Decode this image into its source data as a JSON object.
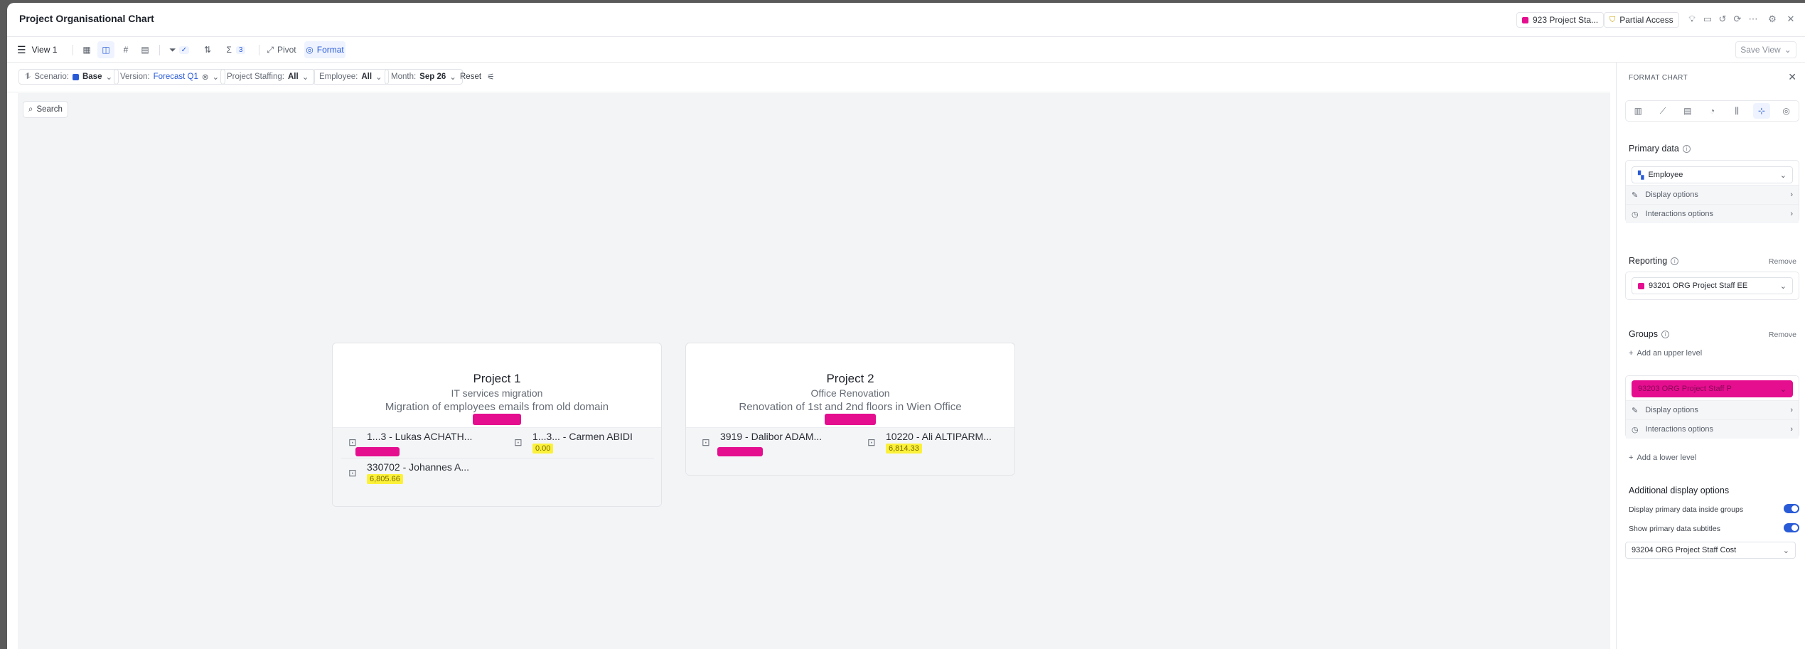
{
  "app": {
    "title": "Project Organisational Chart"
  },
  "header": {
    "model_badge": "923 Project Sta...",
    "access_badge": "Partial Access",
    "icons": [
      "lightbulb-icon",
      "comment-icon",
      "history-icon",
      "refresh-icon",
      "more-icon",
      "settings-icon",
      "close-icon"
    ]
  },
  "toolbar": {
    "view_label": "View 1",
    "sum_count": "3",
    "pivot_label": "Pivot",
    "format_label": "Format",
    "save_view_label": "Save View"
  },
  "filters": {
    "scenario_label": "Scenario:",
    "scenario_value": "Base",
    "version_label": "Version:",
    "version_value": "Forecast Q1",
    "staffing_label": "Project Staffing:",
    "staffing_value": "All",
    "employee_label": "Employee:",
    "employee_value": "All",
    "month_label": "Month:",
    "month_value": "Sep 26",
    "reset_label": "Reset"
  },
  "canvas": {
    "search_label": "Search"
  },
  "projects": [
    {
      "title": "Project 1",
      "subtitle": "IT services migration",
      "description": "Migration of employees emails from old domain",
      "employees": [
        {
          "name": "1...3 - Lukas ACHATH...",
          "value": ""
        },
        {
          "name": "1...3... - Carmen ABIDI",
          "value": "0.00"
        },
        {
          "name": "330702 - Johannes A...",
          "value": "6,805.66"
        }
      ]
    },
    {
      "title": "Project 2",
      "subtitle": "Office Renovation",
      "description": "Renovation of 1st and 2nd floors in Wien Office",
      "employees": [
        {
          "name": "3919 - Dalibor ADAM...",
          "value": ""
        },
        {
          "name": "10220 - Ali ALTIPARM...",
          "value": "6,814.33"
        }
      ]
    }
  ],
  "format_panel": {
    "heading": "FORMAT CHART",
    "primary_data_label": "Primary data",
    "primary_select": "Employee",
    "display_options": "Display options",
    "interactions_options": "Interactions options",
    "reporting_label": "Reporting",
    "reporting_remove": "Remove",
    "reporting_select": "93201 ORG Project Staff EE",
    "groups_label": "Groups",
    "groups_remove": "Remove",
    "add_upper": "Add an upper level",
    "groups_select": "93203 ORG Project Staff P",
    "add_lower": "Add a lower level",
    "additional_label": "Additional display options",
    "toggle1": "Display primary data inside groups",
    "toggle2": "Show primary data subtitles",
    "subtitle_select": "93204 ORG Project Staff Cost"
  }
}
